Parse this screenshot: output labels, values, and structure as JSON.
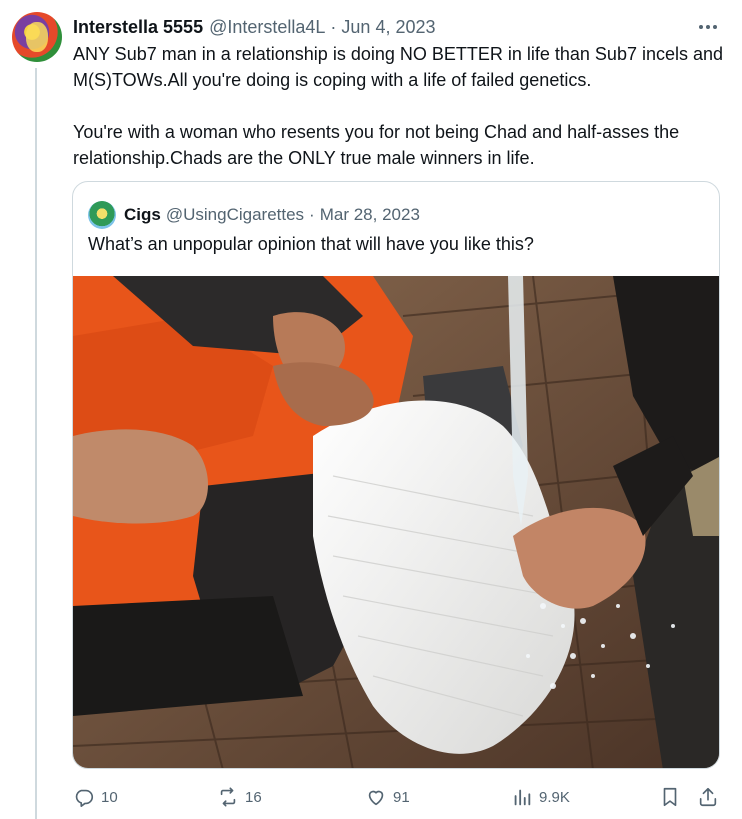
{
  "tweet": {
    "display_name": "Interstella 5555",
    "handle": "@Interstella4L",
    "separator": "·",
    "date": "Jun 4, 2023",
    "text_paragraphs": [
      "ANY Sub7 man in a relationship is doing NO BETTER in life than Sub7 incels and M(S)TOWs.All you're doing is coping with a life of failed genetics.",
      "You're with a woman who resents you for not being Chad and half-asses the relationship.Chads are the ONLY true male winners in life."
    ],
    "more_icon": "ellipsis-icon"
  },
  "quoted_tweet": {
    "display_name": "Cigs",
    "handle": "@UsingCigarettes",
    "separator": "·",
    "date": "Mar 28, 2023",
    "text": "What’s an unpopular opinion that will have you like this?"
  },
  "actions": {
    "reply": {
      "icon": "reply-icon",
      "count": "10"
    },
    "retweet": {
      "icon": "retweet-icon",
      "count": "16"
    },
    "like": {
      "icon": "heart-icon",
      "count": "91"
    },
    "views": {
      "icon": "views-chart-icon",
      "count": "9.9K"
    },
    "bookmark": {
      "icon": "bookmark-icon"
    },
    "share": {
      "icon": "share-icon"
    }
  },
  "colors": {
    "text_primary": "#0f1419",
    "text_secondary": "#536471",
    "border": "#cfd9de",
    "jumpsuit_orange": "#e8551a",
    "towel_white": "#f2f2f0",
    "pavement": "#6b4a35"
  }
}
